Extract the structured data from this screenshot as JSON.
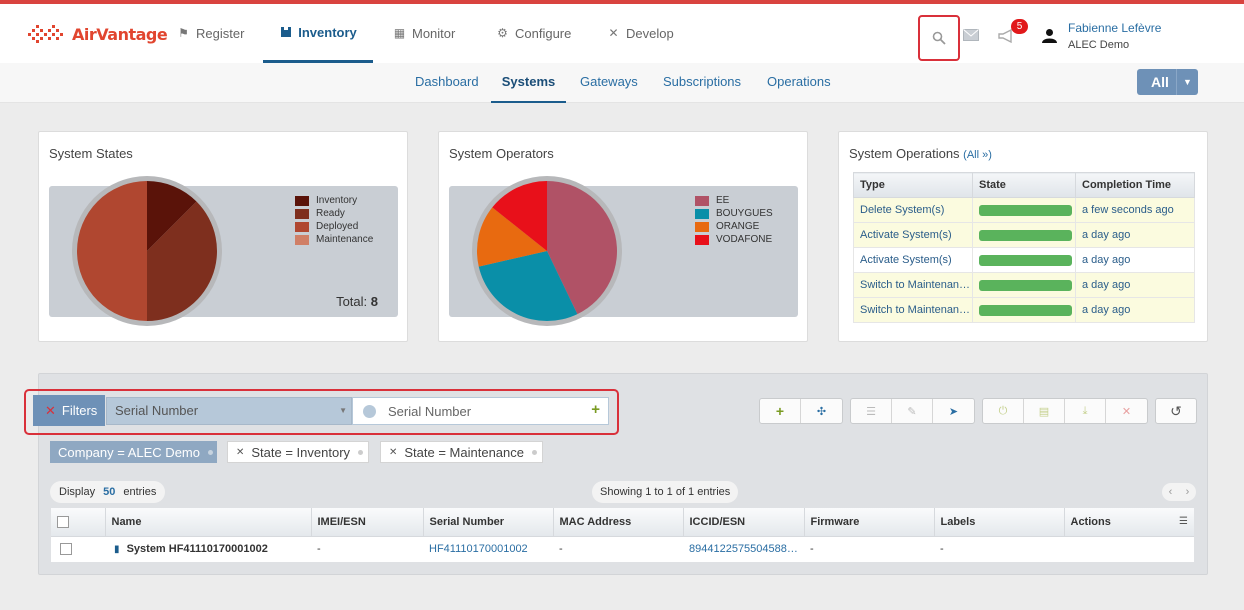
{
  "header": {
    "brand": "AirVantage",
    "nav": [
      {
        "label": "Register",
        "icon": "register-icon"
      },
      {
        "label": "Inventory",
        "icon": "inventory-icon",
        "active": true
      },
      {
        "label": "Monitor",
        "icon": "monitor-icon"
      },
      {
        "label": "Configure",
        "icon": "gear-icon"
      },
      {
        "label": "Develop",
        "icon": "tools-icon"
      }
    ],
    "notifications_count": "5",
    "user_name": "Fabienne Lefèvre",
    "user_company": "ALEC Demo"
  },
  "subnav": {
    "items": [
      {
        "label": "Dashboard"
      },
      {
        "label": "Systems",
        "active": true
      },
      {
        "label": "Gateways"
      },
      {
        "label": "Subscriptions"
      },
      {
        "label": "Operations"
      }
    ],
    "scope_button": "All"
  },
  "system_states": {
    "title": "System States",
    "legend": [
      {
        "label": "Inventory",
        "color": "#5a1309"
      },
      {
        "label": "Ready",
        "color": "#7e2f1e"
      },
      {
        "label": "Deployed",
        "color": "#b04730"
      },
      {
        "label": "Maintenance",
        "color": "#d07f66"
      }
    ],
    "total_label": "Total:",
    "total_value": "8"
  },
  "system_operators": {
    "title": "System Operators",
    "legend": [
      {
        "label": "EE",
        "color": "#b05266"
      },
      {
        "label": "BOUYGUES",
        "color": "#0a8fa8"
      },
      {
        "label": "ORANGE",
        "color": "#e86a10"
      },
      {
        "label": "VODAFONE",
        "color": "#e8101a"
      }
    ]
  },
  "chart_data": [
    {
      "type": "pie",
      "title": "System States",
      "categories": [
        "Inventory",
        "Ready",
        "Deployed",
        "Maintenance"
      ],
      "values": [
        1,
        3,
        4,
        0
      ],
      "colors": [
        "#5a1309",
        "#7e2f1e",
        "#b04730",
        "#d07f66"
      ]
    },
    {
      "type": "pie",
      "title": "System Operators",
      "categories": [
        "EE",
        "BOUYGUES",
        "ORANGE",
        "VODAFONE"
      ],
      "values": [
        3,
        2,
        1,
        1
      ],
      "colors": [
        "#b05266",
        "#0a8fa8",
        "#e86a10",
        "#e8101a"
      ]
    }
  ],
  "system_operations": {
    "title": "System Operations",
    "all_link": "(All »)",
    "columns": [
      "Type",
      "State",
      "Completion Time"
    ],
    "rows": [
      {
        "type": "Delete System(s)",
        "progress": 1.0,
        "time": "a few seconds ago"
      },
      {
        "type": "Activate System(s)",
        "progress": 1.0,
        "time": "a day ago"
      },
      {
        "type": "Activate System(s)",
        "progress": 1.0,
        "time": "a day ago"
      },
      {
        "type": "Switch to Maintenan…",
        "progress": 1.0,
        "time": "a day ago"
      },
      {
        "type": "Switch to Maintenan…",
        "progress": 1.0,
        "time": "a day ago"
      }
    ]
  },
  "filters": {
    "button_label": "Filters",
    "field": "Serial Number",
    "search_placeholder": "Serial Number",
    "chips": [
      {
        "label": "Company = ALEC Demo",
        "removable": false
      },
      {
        "label": "State = Inventory",
        "removable": true
      },
      {
        "label": "State = Maintenance",
        "removable": true
      }
    ]
  },
  "table": {
    "display_label": "Display",
    "display_count": "50",
    "display_suffix": "entries",
    "showing": "Showing 1 to 1 of 1 entries",
    "columns": [
      "Name",
      "IMEI/ESN",
      "Serial Number",
      "MAC Address",
      "ICCID/ESN",
      "Firmware",
      "Labels",
      "Actions"
    ],
    "rows": [
      {
        "name": "System HF41110170001002",
        "imei": "-",
        "serial": "HF41110170001002",
        "mac": "-",
        "iccid": "8944122575504588…",
        "firmware": "-",
        "labels": "-",
        "actions": ""
      }
    ]
  }
}
